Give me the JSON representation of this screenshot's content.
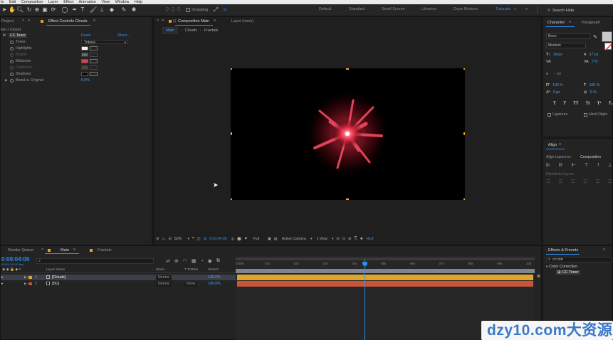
{
  "menubar": [
    "le",
    "Edit",
    "Composition",
    "Layer",
    "Effect",
    "Animation",
    "View",
    "Window",
    "Help"
  ],
  "toolbar": {
    "snapping": "Snapping",
    "workspaces": [
      "Default",
      "Standard",
      "Small Screen",
      "Libraries",
      "Dope Motions",
      "Tutorials"
    ],
    "active_workspace": "Tutorials",
    "search_help": "Search Help"
  },
  "project_panel": {
    "tab_project": "Project",
    "tab_effect_controls": "Effect Controls Clouds",
    "breadcrumb": "lain • Clouds",
    "effect_name": "CC Toner",
    "reset": "Reset",
    "about": "About...",
    "properties": [
      {
        "label": "Tones",
        "value": "Tritone",
        "kind": "dropdown"
      },
      {
        "label": "Highlights",
        "color": "#f5f5f5",
        "kind": "color"
      },
      {
        "label": "Brights",
        "color": "#c9c3b8",
        "kind": "color",
        "dim": true
      },
      {
        "label": "Midtones",
        "color": "#e43a4a",
        "kind": "color"
      },
      {
        "label": "Darktones",
        "color": "#7b7467",
        "kind": "color",
        "dim": true
      },
      {
        "label": "Shadows",
        "color": "#0a0a0a",
        "kind": "color"
      },
      {
        "label": "Blend w. Original",
        "value": "0.0%",
        "kind": "value"
      }
    ]
  },
  "composition_panel": {
    "tab": "Composition Main",
    "layer_tab": "Layer (none)",
    "crumbs": [
      "Main",
      "Clouds",
      "Fractals"
    ],
    "zoom": "50%",
    "timecode": "0:00:04:09",
    "resolution": "Full",
    "camera": "Active Camera",
    "view": "1 View",
    "exposure": "+0.0"
  },
  "character_panel": {
    "tab_character": "Character",
    "tab_paragraph": "Paragraph",
    "font": "Boon",
    "style": "Medium",
    "size": "34 px",
    "leading": "67 px",
    "kerning": "",
    "tracking": "770",
    "stroke": "- px",
    "vscale": "100 %",
    "hscale": "100 %",
    "baseline": "0 px",
    "tsume": "0 %",
    "styles": [
      "T",
      "T",
      "TT",
      "Tt",
      "T¹",
      "T₁"
    ],
    "ligatures": "Ligatures",
    "hindi": "Hindi Digits"
  },
  "align_panel": {
    "tab": "Align",
    "align_to_label": "Align Layers to:",
    "align_to_value": "Composition",
    "distribute": "Distribute Layers"
  },
  "effects_panel": {
    "tab": "Effects & Presets",
    "search": "cc ton",
    "category": "Color Correction",
    "item": "CC Toner"
  },
  "timeline": {
    "tab_render": "Render Queue",
    "tab_main": "Main",
    "tab_fractals": "Fractals",
    "timecode": "0:00:04:09",
    "timecode_sub": "00109 (25.00 fps)",
    "col_layer_name": "Layer Name",
    "col_mode": "Mode",
    "col_trkmat": "T  TrkMat",
    "col_stretch": "Stretch",
    "layers": [
      {
        "num": "1",
        "name": "[Clouds]",
        "mode": "Norma",
        "trkmat": "",
        "stretch": "100.0%",
        "color": "#e1a32c",
        "selected": true
      },
      {
        "num": "2",
        "name": "[BG]",
        "mode": "Norma",
        "trkmat": "None",
        "stretch": "100.0%",
        "color": "#c8553a",
        "selected": false
      }
    ],
    "ruler_ticks": [
      "0:00s",
      "01s",
      "02s",
      "03s",
      "04s",
      "05s",
      "06s",
      "07s",
      "08s",
      "09s",
      "10s"
    ],
    "current_time_fraction": 0.43
  },
  "watermark": "dzy10.com大资源网"
}
